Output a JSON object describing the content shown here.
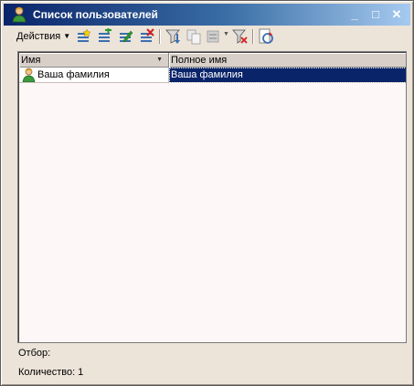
{
  "window": {
    "title": "Список пользователей",
    "controls": {
      "minimize": "_",
      "maximize": "□",
      "close": "✕"
    }
  },
  "toolbar": {
    "actions_label": "Действия",
    "icons": [
      "add-icon",
      "add-group-icon",
      "edit-icon",
      "delete-icon",
      "hierarchy-filter-icon",
      "copy-icon",
      "filter-icon",
      "clear-filter-icon",
      "refresh-icon"
    ]
  },
  "table": {
    "columns": [
      "Имя",
      "Полное имя"
    ],
    "rows": [
      {
        "name": "Ваша фамилия",
        "full_name": "Ваша фамилия",
        "selected_column": "full_name"
      }
    ]
  },
  "status": {
    "filter_label": "Отбор:",
    "count_label": "Количество: 1"
  },
  "colors": {
    "title_bar_start": "#0a246a",
    "title_bar_end": "#a6caf0",
    "window_bg": "#ece3d9",
    "grid_bg": "#fef7f8",
    "selection": "#0a246a"
  }
}
